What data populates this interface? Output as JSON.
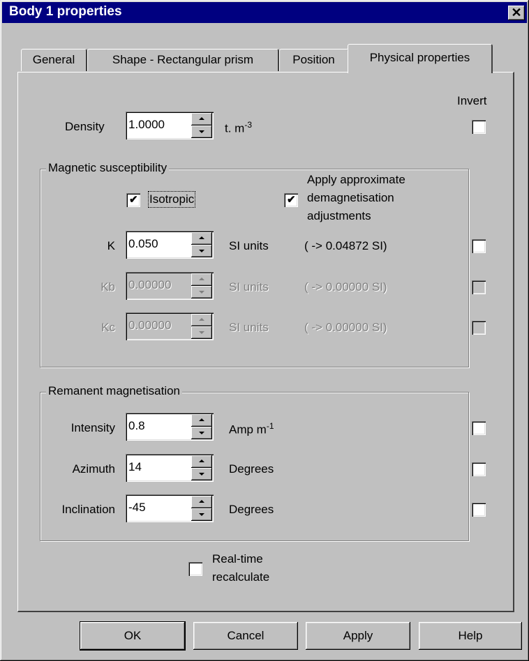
{
  "window": {
    "title": "Body 1 properties",
    "close_glyph": "✕"
  },
  "tabs": [
    {
      "label": "General"
    },
    {
      "label": "Shape - Rectangular prism"
    },
    {
      "label": "Position"
    },
    {
      "label": "Physical properties"
    }
  ],
  "active_tab": "Physical properties",
  "invert_header": "Invert",
  "density": {
    "label": "Density",
    "value": "1.0000",
    "unit": "t. m",
    "unit_exp": "-3",
    "invert": false
  },
  "magnetic": {
    "group_label": "Magnetic susceptibility",
    "isotropic": {
      "label": "Isotropic",
      "checked": true
    },
    "demag": {
      "label_lines": [
        "Apply approximate",
        "demagnetisation",
        "adjustments"
      ],
      "checked": true
    },
    "rows": [
      {
        "label": "K",
        "value": "0.050",
        "unit": "SI units",
        "result": "( ->  0.04872 SI)",
        "enabled": true,
        "invert": false
      },
      {
        "label": "Kb",
        "value": "0.00000",
        "unit": "SI units",
        "result": "( ->  0.00000 SI)",
        "enabled": false,
        "invert": false
      },
      {
        "label": "Kc",
        "value": "0.00000",
        "unit": "SI units",
        "result": "( ->  0.00000 SI)",
        "enabled": false,
        "invert": false
      }
    ]
  },
  "remanent": {
    "group_label": "Remanent magnetisation",
    "rows": [
      {
        "label": "Intensity",
        "value": "0.8",
        "unit": "Amp m",
        "unit_exp": "-1",
        "invert": false
      },
      {
        "label": "Azimuth",
        "value": "14",
        "unit": "Degrees",
        "invert": false
      },
      {
        "label": "Inclination",
        "value": "-45",
        "unit": "Degrees",
        "invert": false
      }
    ]
  },
  "realtime": {
    "label_lines": [
      "Real-time",
      "recalculate"
    ],
    "checked": false
  },
  "buttons": {
    "ok": "OK",
    "cancel": "Cancel",
    "apply": "Apply",
    "help": "Help"
  },
  "colors": {
    "titlebar": "#000080",
    "face": "#c0c0c0",
    "disabled_text": "#808080"
  }
}
